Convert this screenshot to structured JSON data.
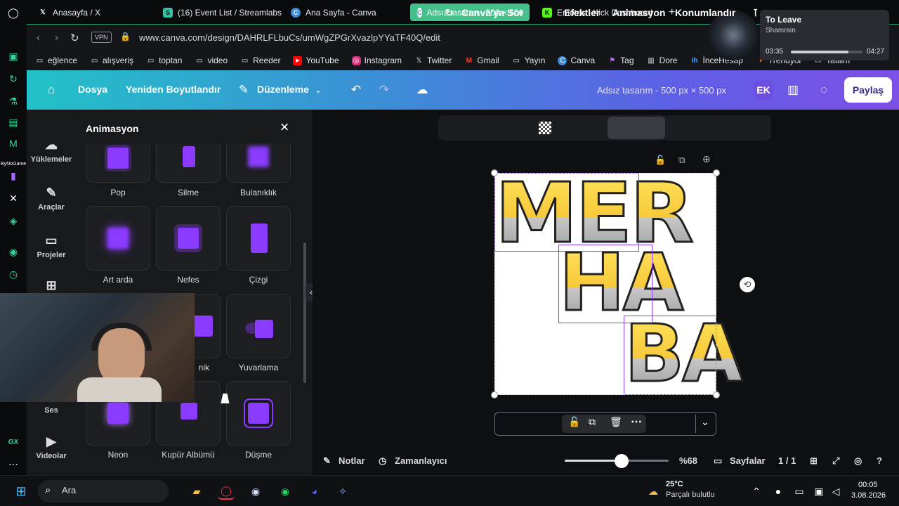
{
  "browser": {
    "tabs": [
      {
        "label": "Anasayfa / X",
        "icon": "x-icon"
      },
      {
        "label": "(16) Event List / Streamlabs",
        "icon": "streamlabs-icon"
      },
      {
        "label": "Ana Sayfa - Canva",
        "icon": "canva-icon"
      },
      {
        "label": "Adsız tasarım - 500 × 500",
        "icon": "canva-icon",
        "active": true
      },
      {
        "label": "Emotes - Kick Dashboard",
        "icon": "kick-icon"
      }
    ],
    "vpn_badge": "VPN",
    "url": "www.canva.com/design/DAHRLFLbuCs/umWgZPGrXvazlpYYaTF40Q/edit",
    "bookmarks": [
      "eğlence",
      "alışveriş",
      "toptan",
      "video",
      "Reeder",
      "YouTube",
      "Instagram",
      "Twitter",
      "Gmail",
      "Yayın",
      "Canva",
      "Tag",
      "Dore",
      "İnceHesap",
      "Trendyol",
      "Tatilim"
    ]
  },
  "media_widget": {
    "title": "To Leave",
    "artist": "Shamrain",
    "elapsed": "03:35",
    "total": "04:27",
    "progress": 0.8
  },
  "canva_header": {
    "file": "Dosya",
    "resize": "Yeniden Boyutlandır",
    "edit": "Düzenleme",
    "design_title": "Adsız tasarım - 500 px × 500 px",
    "avatar": "EK",
    "share": "Paylaş",
    "accent_start": "#23c1c8",
    "accent_end": "#7d4fe6"
  },
  "left_rail": {
    "items": [
      "Yüklemeler",
      "Araçlar",
      "Projeler",
      "Ses",
      "Videolar"
    ]
  },
  "animation_panel": {
    "title": "Animasyon",
    "rows": [
      [
        "Pop",
        "Silme",
        "Bulanıklık"
      ],
      [
        "Art arda",
        "Nefes",
        "Çizgi"
      ],
      [
        "nik",
        "",
        "Yuvarlama"
      ],
      [
        "Neon",
        "Kupür Albümü",
        "Düşme"
      ]
    ]
  },
  "context_toolbar": {
    "ask": "Canva'ya Sor",
    "effects": "Efektler",
    "animation": "Animasyon",
    "position": "Konumlandır"
  },
  "canvas": {
    "lines": [
      "MER",
      "HA",
      "BA"
    ],
    "text_color": "#f6d146"
  },
  "footer": {
    "notes": "Notlar",
    "timer": "Zamanlayıcı",
    "zoom": "%68",
    "zoom_fraction": 0.55,
    "pages": "Sayfalar",
    "page_count": "1 / 1"
  },
  "sidebar_labels": {
    "gx": "GX",
    "bynogame": "ByNoGame"
  },
  "taskbar": {
    "search": "Ara",
    "weather_temp": "25°C",
    "weather_desc": "Parçalı bulutlu",
    "time": "00:05",
    "date": "3.08.2026"
  }
}
